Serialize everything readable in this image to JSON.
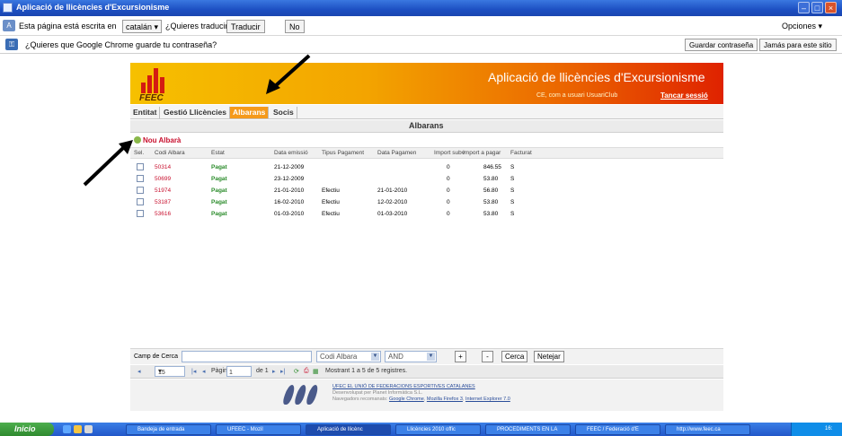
{
  "window": {
    "title": "Aplicació de llicències d'Excursionisme"
  },
  "translate_bar": {
    "message": "Esta página está escrita en",
    "language": "catalán",
    "question": "¿Quieres traducirla?",
    "translate_button": "Traducir",
    "no_button": "No",
    "options": "Opciones"
  },
  "password_bar": {
    "message": "¿Quieres que Google Chrome guarde tu contraseña?",
    "save_button": "Guardar contraseña",
    "never_button": "Jamás para este sitio"
  },
  "app": {
    "logo_text": "FEEC",
    "title": "Aplicació de llicències d'Excursionisme",
    "user_line": "CE, com a usuari UsuariClub",
    "logout": "Tancar sessió",
    "menu": [
      "Entitat",
      "Gestió Llicències",
      "Albarans",
      "Socis"
    ],
    "active_menu": "Albarans",
    "section_title": "Albarans",
    "new_link": "Nou Albarà",
    "grid": {
      "columns": [
        "Sel.",
        "Codi Albara",
        "Estat",
        "Data emissió",
        "Tipus Pagament",
        "Data Pagamen",
        "Import subv",
        "Import a pagar",
        "Facturat"
      ],
      "rows": [
        {
          "code": "50314",
          "state": "Pagat",
          "emitted": "21-12-2009",
          "pay_type": "",
          "pay_date": "",
          "subsidy": "0",
          "amount": "846.55",
          "invoiced": "S"
        },
        {
          "code": "50699",
          "state": "Pagat",
          "emitted": "23-12-2009",
          "pay_type": "",
          "pay_date": "",
          "subsidy": "0",
          "amount": "53.80",
          "invoiced": "S"
        },
        {
          "code": "51974",
          "state": "Pagat",
          "emitted": "21-01-2010",
          "pay_type": "Efectiu",
          "pay_date": "21-01-2010",
          "subsidy": "0",
          "amount": "56.80",
          "invoiced": "S"
        },
        {
          "code": "53187",
          "state": "Pagat",
          "emitted": "16-02-2010",
          "pay_type": "Efectiu",
          "pay_date": "12-02-2010",
          "subsidy": "0",
          "amount": "53.80",
          "invoiced": "S"
        },
        {
          "code": "53616",
          "state": "Pagat",
          "emitted": "01-03-2010",
          "pay_type": "Efectiu",
          "pay_date": "01-03-2010",
          "subsidy": "0",
          "amount": "53.80",
          "invoiced": "S"
        }
      ]
    },
    "search": {
      "label": "Camp de Cerca",
      "field": "Codi Albara",
      "operator": "AND",
      "plus": "+",
      "minus": "-",
      "search_button": "Cerca",
      "clear_button": "Netejar"
    },
    "pager": {
      "page_size": "15",
      "page_label": "Pàgina",
      "page": "1",
      "of_label": "de 1",
      "status": "Mostrant 1 a 5 de 5 registres."
    },
    "footer": {
      "line1": "UFEC EL UNIÓ DE FEDERACIONS ESPORTIVES CATALANES",
      "line2": "Desenvolupat per Planet Informàtica S.L.",
      "line3_prefix": "Navegadors recomanats:",
      "browser1": "Google Chrome",
      "browser2": "Mozilla Firefox 3",
      "browser3": "Internet Explorer 7.0"
    }
  },
  "taskbar": {
    "start": "Inicio",
    "tasks": [
      "Bandeja de entrada",
      "UFEEC - Mozil",
      "Aplicació de llicènc",
      "Llicències 2010 offic",
      "PROCEDIMENTS EN LA",
      "FEEC / Federació d'E",
      "http://www.feec.ca"
    ],
    "clock": "16:"
  },
  "colors": {
    "accent": "#f59a1b",
    "code": "#c8102e",
    "state": "#2a8b2a",
    "link": "#2a4d9a"
  }
}
